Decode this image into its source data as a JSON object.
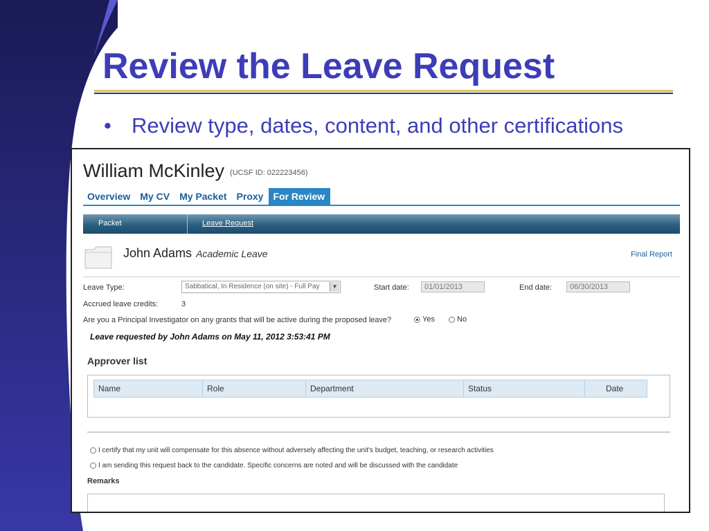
{
  "slide": {
    "title": "Review the Leave Request",
    "bullet": "Review type, dates, content, and other certifications"
  },
  "app": {
    "user_name": "William McKinley",
    "ucsf_id": "(UCSF ID: 022223456)",
    "tabs": [
      {
        "label": "Overview",
        "active": false
      },
      {
        "label": "My CV",
        "active": false
      },
      {
        "label": "My Packet",
        "active": false
      },
      {
        "label": "Proxy",
        "active": false
      },
      {
        "label": "For Review",
        "active": true
      }
    ],
    "subnav": {
      "packet": "Packet",
      "leave_request": "Leave Request"
    },
    "candidate": {
      "name": "John Adams",
      "type": "Academic Leave",
      "final_report": "Final Report"
    },
    "form": {
      "leave_type_label": "Leave Type:",
      "leave_type_value": "Sabbatical, In Residence (on site) - Full Pay",
      "start_label": "Start date:",
      "start_value": "01/01/2013",
      "end_label": "End date:",
      "end_value": "06/30/2013",
      "credits_label": "Accrued leave credits:",
      "credits_value": "3",
      "pi_question": "Are you a Principal Investigator on any grants that will be active during the proposed leave?",
      "pi_yes": "Yes",
      "pi_no": "No",
      "pi_selected": "Yes"
    },
    "leave_requested": "Leave requested by John Adams on May 11, 2012 3:53:41  PM",
    "approver": {
      "title": "Approver list",
      "columns": [
        "Name",
        "Role",
        "Department",
        "Status",
        "Date"
      ]
    },
    "certify_1": "I certify that my unit will compensate for this absence without adversely affecting the unit's budget, teaching, or research activities",
    "certify_2": "I am sending this request back to the candidate. Specific concerns are noted and will be discussed with the candidate",
    "remarks_label": "Remarks"
  }
}
